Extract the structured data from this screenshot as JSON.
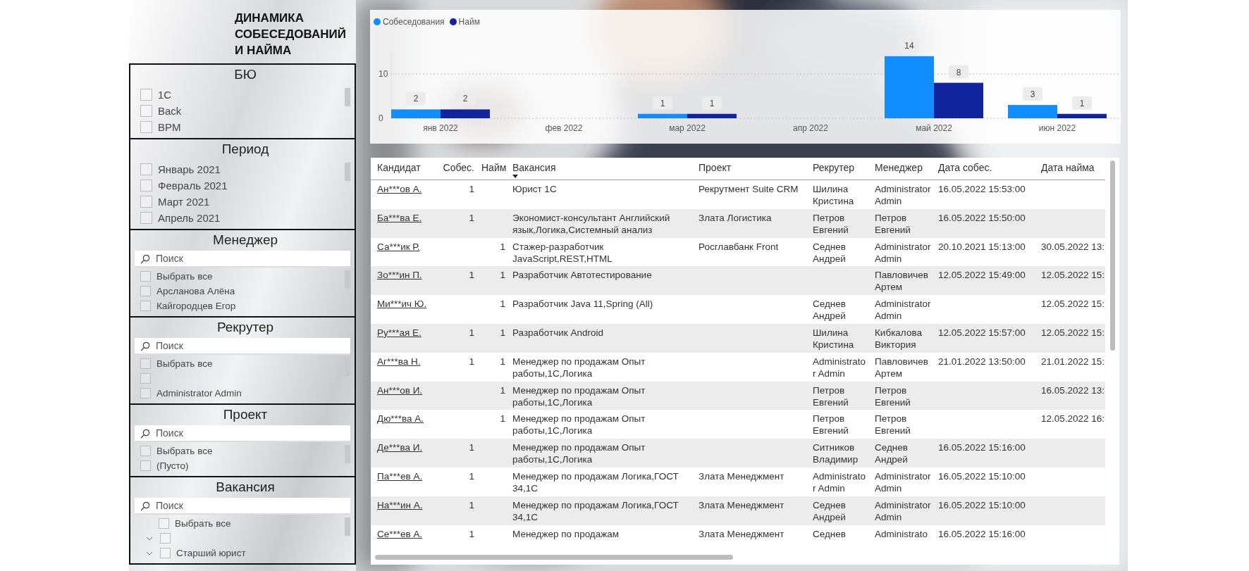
{
  "title": "ДИНАМИКА СОБЕСЕДОВАНИЙ И НАЙМА",
  "slicers": [
    {
      "title": "БЮ",
      "items": [
        {
          "kind": "item",
          "label": "1С",
          "checked": false
        },
        {
          "kind": "item",
          "label": "Back",
          "checked": false
        },
        {
          "kind": "item",
          "label": "BPM",
          "checked": false
        }
      ]
    },
    {
      "title": "Период",
      "items": [
        {
          "kind": "item",
          "label": "Январь 2021",
          "checked": false
        },
        {
          "kind": "item",
          "label": "Февраль 2021",
          "checked": false
        },
        {
          "kind": "item",
          "label": "Март 2021",
          "checked": false
        },
        {
          "kind": "item",
          "label": "Апрель 2021",
          "checked": false
        }
      ]
    },
    {
      "title": "Менеджер",
      "search": {
        "placeholder": "Поиск"
      },
      "items": [
        {
          "kind": "item",
          "label": "Выбрать все",
          "checked": false
        },
        {
          "kind": "item",
          "label": "Арсланова Алёна",
          "checked": false
        },
        {
          "kind": "item",
          "label": "Кайгородцев Егор",
          "checked": false
        }
      ]
    },
    {
      "title": "Рекрутер",
      "search": {
        "placeholder": "Поиск"
      },
      "items": [
        {
          "kind": "item",
          "label": "Выбрать все",
          "checked": false
        },
        {
          "kind": "item",
          "checked": false
        },
        {
          "kind": "item",
          "label": "Administrator Admin",
          "checked": false
        }
      ]
    },
    {
      "title": "Проект",
      "search": {
        "placeholder": "Поиск"
      },
      "items": [
        {
          "kind": "item",
          "label": "Выбрать все",
          "checked": false
        },
        {
          "kind": "item",
          "label": "(Пусто)",
          "checked": false
        }
      ]
    },
    {
      "title": "Вакансия",
      "search": {
        "placeholder": "Поиск"
      },
      "items": [
        {
          "kind": "select_all",
          "label": "Выбрать все",
          "checked": false
        },
        {
          "kind": "group",
          "checked": false
        },
        {
          "kind": "group",
          "label": "Старший юрист",
          "checked": false
        }
      ]
    }
  ],
  "chart": {
    "chart_data": {
      "type": "bar",
      "categories": [
        "янв 2022",
        "фев 2022",
        "мар 2022",
        "апр 2022",
        "май 2022",
        "июн 2022"
      ],
      "series": [
        {
          "name": "Собеседования",
          "color": "#118dff",
          "values": [
            2,
            null,
            1,
            null,
            14,
            3
          ]
        },
        {
          "name": "Найм",
          "color": "#12239e",
          "values": [
            2,
            null,
            1,
            null,
            8,
            1
          ]
        }
      ],
      "ylim": [
        0,
        15
      ],
      "yticks": [
        0,
        10
      ],
      "data_labels": true
    }
  },
  "table": {
    "columns": [
      {
        "label": "Кандидат",
        "sorted": false
      },
      {
        "label": "Собес.",
        "sorted": false
      },
      {
        "label": "Найм",
        "sorted": false
      },
      {
        "label": "Вакансия",
        "sorted": true
      },
      {
        "label": "Проект",
        "sorted": false
      },
      {
        "label": "Рекрутер",
        "sorted": false
      },
      {
        "label": "Менеджер",
        "sorted": false
      },
      {
        "label": "Дата собес.",
        "sorted": false
      },
      {
        "label": "Дата найма",
        "sorted": false
      }
    ],
    "rows": [
      {
        "candidate": "Ан***ов А.",
        "interviews": "1",
        "vacancy": "Юрист 1С",
        "project": "Рекрутмент Suite CRM",
        "recruiter": "Шилина Кристина",
        "manager": "Administrator Admin",
        "interview_date": "16.05.2022 15:53:00"
      },
      {
        "candidate": "Ба***ва Е.",
        "interviews": "1",
        "vacancy": "Экономист-консультант Английский язык,Логика,Системный анализ",
        "project": "Злата Логистика",
        "recruiter": "Петров Евгений",
        "manager": "Петров Евгений",
        "interview_date": "16.05.2022 15:50:00"
      },
      {
        "candidate": "Са***ик Р.",
        "hires": "1",
        "vacancy": "Стажер-разработчик JavaScript,REST,HTML",
        "project": "Росглавбанк Front",
        "recruiter": "Седнев Андрей",
        "manager": "Administrator Admin",
        "interview_date": "20.10.2021 15:13:00",
        "hire_date": "30.05.2022 13:"
      },
      {
        "candidate": "Зо***ин П.",
        "interviews": "1",
        "hires": "1",
        "vacancy": "Разработчик Автотестирование",
        "manager": "Павловичев Артем",
        "interview_date": "12.05.2022 15:49:00",
        "hire_date": "12.05.2022 15:"
      },
      {
        "candidate": "Ми***ич Ю.",
        "hires": "1",
        "vacancy": "Разработчик Java 11,Spring (All)",
        "recruiter": "Седнев Андрей",
        "manager": "Administrator Admin",
        "hire_date": "12.05.2022 15:"
      },
      {
        "candidate": "Ру***ая Е.",
        "interviews": "1",
        "hires": "1",
        "vacancy": "Разработчик Android",
        "recruiter": "Шилина Кристина",
        "manager": "Кибкалова Виктория",
        "interview_date": "12.05.2022 15:57:00",
        "hire_date": "12.05.2022 15:"
      },
      {
        "candidate": "Аг***ва Н.",
        "interviews": "1",
        "hires": "1",
        "vacancy": "Менеджер по продажам Опыт работы,1С,Логика",
        "recruiter": "Administrator Admin",
        "manager": "Павловичев Артем",
        "interview_date": "21.01.2022 13:50:00",
        "hire_date": "21.01.2022 15:"
      },
      {
        "candidate": "Ан***ов И.",
        "hires": "1",
        "vacancy": "Менеджер по продажам Опыт работы,1С,Логика",
        "recruiter": "Петров Евгений",
        "manager": "Петров Евгений",
        "hire_date": "16.05.2022 13:"
      },
      {
        "candidate": "Дю***ва А.",
        "hires": "1",
        "vacancy": "Менеджер по продажам Опыт работы,1С,Логика",
        "recruiter": "Петров Евгений",
        "manager": "Петров Евгений",
        "hire_date": "12.05.2022 16:"
      },
      {
        "candidate": "Де***ва И.",
        "interviews": "1",
        "vacancy": "Менеджер по продажам Опыт работы,1С,Логика",
        "recruiter": "Ситников Владимир",
        "manager": "Седнев Андрей",
        "interview_date": "16.05.2022 15:16:00"
      },
      {
        "candidate": "Па***ев А.",
        "interviews": "1",
        "vacancy": "Менеджер по продажам Логика,ГОСТ 34,1С",
        "project": "Злата Менеджмент",
        "recruiter": "Administrator Admin",
        "manager": "Administrator Admin",
        "interview_date": "16.05.2022 15:10:00"
      },
      {
        "candidate": "На***ин А.",
        "interviews": "1",
        "vacancy": "Менеджер по продажам Логика,ГОСТ 34,1С",
        "project": "Злата Менеджмент",
        "recruiter": "Седнев Андрей",
        "manager": "Administrator Admin",
        "interview_date": "16.05.2022 15:10:00"
      },
      {
        "candidate": "Се***ев А.",
        "interviews": "1",
        "vacancy": "Менеджер по продажам",
        "project": "Злата Менеджмент",
        "recruiter": "Седнев",
        "manager": "Administrato",
        "interview_date": "16.05.2022 15:16:00"
      }
    ]
  }
}
